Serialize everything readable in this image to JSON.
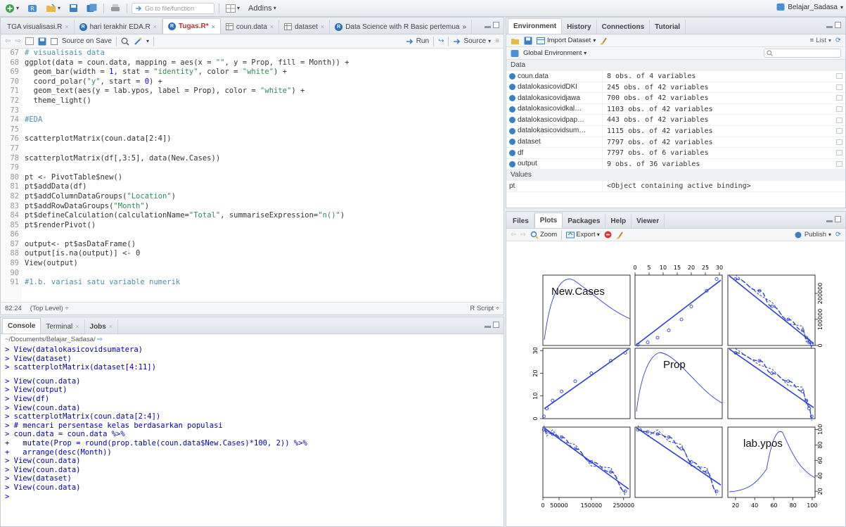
{
  "toolbar": {
    "goto_placeholder": "Go to file/function",
    "addins_label": "Addins",
    "project_name": "Belajar_Sadasa"
  },
  "editor": {
    "tabs": [
      {
        "label": "TGA visualisasi.R"
      },
      {
        "label": "hari terakhir EDA.R"
      },
      {
        "label": "Tugas.R*"
      },
      {
        "label": "coun.data"
      },
      {
        "label": "dataset"
      },
      {
        "label": "Data Science with R Basic pertemua"
      }
    ],
    "more_tabs": "»",
    "source_on_save_label": "Source on Save",
    "run_label": "Run",
    "source_label": "Source",
    "lines": [
      {
        "n": "67",
        "t": "# visualisais data",
        "cls": "cmt"
      },
      {
        "n": "68",
        "t": "ggplot(data = coun.data, mapping = aes(x = \"\", y = Prop, fill = Month)) +",
        "cls": ""
      },
      {
        "n": "69",
        "t": "  geom_bar(width = 1, stat = \"identity\", color = \"white\") +",
        "cls": ""
      },
      {
        "n": "70",
        "t": "  coord_polar(\"y\", start = 0) +",
        "cls": ""
      },
      {
        "n": "71",
        "t": "  geom_text(aes(y = lab.ypos, label = Prop), color = \"white\") +",
        "cls": ""
      },
      {
        "n": "72",
        "t": "  theme_light()",
        "cls": ""
      },
      {
        "n": "73",
        "t": "",
        "cls": ""
      },
      {
        "n": "74",
        "t": "#EDA",
        "cls": "cmt"
      },
      {
        "n": "75",
        "t": "",
        "cls": ""
      },
      {
        "n": "76",
        "t": "scatterplotMatrix(coun.data[2:4])",
        "cls": ""
      },
      {
        "n": "77",
        "t": "",
        "cls": ""
      },
      {
        "n": "78",
        "t": "scatterplotMatrix(df[,3:5], data(New.Cases))",
        "cls": ""
      },
      {
        "n": "79",
        "t": "",
        "cls": ""
      },
      {
        "n": "80",
        "t": "pt <- PivotTable$new()",
        "cls": ""
      },
      {
        "n": "81",
        "t": "pt$addData(df)",
        "cls": ""
      },
      {
        "n": "82",
        "t": "pt$addColumnDataGroups(\"Location\")",
        "cls": ""
      },
      {
        "n": "83",
        "t": "pt$addRowDataGroups(\"Month\")",
        "cls": ""
      },
      {
        "n": "84",
        "t": "pt$defineCalculation(calculationName=\"Total\", summariseExpression=\"n()\")",
        "cls": ""
      },
      {
        "n": "85",
        "t": "pt$renderPivot()",
        "cls": ""
      },
      {
        "n": "86",
        "t": "",
        "cls": ""
      },
      {
        "n": "87",
        "t": "output<- pt$asDataFrame()",
        "cls": ""
      },
      {
        "n": "88",
        "t": "output[is.na(output)] <- 0",
        "cls": ""
      },
      {
        "n": "89",
        "t": "View(output)",
        "cls": ""
      },
      {
        "n": "90",
        "t": "",
        "cls": ""
      },
      {
        "n": "91",
        "t": "#1.b. variasi satu variable numerik",
        "cls": "cmt"
      }
    ],
    "cursor_pos": "82:24",
    "scope": "(Top Level)",
    "file_type": "R Script"
  },
  "console": {
    "tabs": [
      {
        "label": "Console"
      },
      {
        "label": "Terminal"
      },
      {
        "label": "Jobs"
      }
    ],
    "path": "~/Documents/Belajar_Sadasa/",
    "lines_a": [
      "> View(datalokasicovidsumatera)",
      "> View(dataset)",
      "> scatterplotMatrix(dataset[4:11])"
    ],
    "lines_b": [
      "> View(coun.data)",
      "> View(output)",
      "> View(df)",
      "> View(coun.data)",
      "> scatterplotMatrix(coun.data[2:4])",
      "> # mencari persentase kelas berdasarkan populasi",
      "> coun.data = coun.data %>%",
      "+   mutate(Prop = round(prop.table(coun.data$New.Cases)*100, 2)) %>%",
      "+   arrange(desc(Month))",
      "> View(coun.data)",
      "> View(coun.data)",
      "> View(dataset)",
      "> View(coun.data)",
      "> "
    ]
  },
  "env": {
    "tabs": [
      {
        "label": "Environment"
      },
      {
        "label": "History"
      },
      {
        "label": "Connections"
      },
      {
        "label": "Tutorial"
      }
    ],
    "import_label": "Import Dataset",
    "list_label": "List",
    "scope_label": "Global Environment",
    "data_header": "Data",
    "values_header": "Values",
    "rows": [
      {
        "name": "coun.data",
        "value": "8 obs. of 4 variables"
      },
      {
        "name": "datalokasicovidDKI",
        "value": "245 obs. of 42 variables"
      },
      {
        "name": "datalokasicovidjawa",
        "value": "700 obs. of 42 variables"
      },
      {
        "name": "datalokasicovidkal…",
        "value": "1103 obs. of 42 variables"
      },
      {
        "name": "datalokasicovidpap…",
        "value": "443 obs. of 42 variables"
      },
      {
        "name": "datalokasicovidsum…",
        "value": "1115 obs. of 42 variables"
      },
      {
        "name": "dataset",
        "value": "7797 obs. of 42 variables"
      },
      {
        "name": "df",
        "value": "7797 obs. of 6 variables"
      },
      {
        "name": "output",
        "value": "9 obs. of 36 variables"
      }
    ],
    "value_rows": [
      {
        "name": "pt",
        "value": "<Object containing active binding>"
      }
    ]
  },
  "plots": {
    "tabs": [
      {
        "label": "Files"
      },
      {
        "label": "Plots"
      },
      {
        "label": "Packages"
      },
      {
        "label": "Help"
      },
      {
        "label": "Viewer"
      }
    ],
    "zoom_label": "Zoom",
    "export_label": "Export",
    "publish_label": "Publish"
  },
  "chart_data": {
    "type": "scatter",
    "variables": [
      "New.Cases",
      "Prop",
      "lab.ypos"
    ],
    "axes": {
      "New.Cases": {
        "ticks": [
          "0",
          "50000",
          "150000",
          "250000"
        ],
        "range": [
          0,
          270000
        ]
      },
      "Prop": {
        "ticks": [
          "0",
          "5",
          "10",
          "15",
          "20",
          "25",
          "30"
        ],
        "range": [
          0,
          31
        ]
      },
      "lab.ypos": {
        "ticks": [
          "20",
          "40",
          "60",
          "80",
          "100"
        ],
        "range": [
          12,
          103
        ]
      },
      "New.Cases_right": {
        "ticks": [
          "0",
          "100000",
          "200000"
        ],
        "range": [
          0,
          270000
        ]
      }
    },
    "points": [
      {
        "New.Cases": 3000,
        "Prop": 1.0,
        "lab.ypos": 99.5
      },
      {
        "New.Cases": 12000,
        "Prop": 4.5,
        "lab.ypos": 96.8
      },
      {
        "New.Cases": 30000,
        "Prop": 8.0,
        "lab.ypos": 94.0
      },
      {
        "New.Cases": 58000,
        "Prop": 12.0,
        "lab.ypos": 90.0
      },
      {
        "New.Cases": 100000,
        "Prop": 16.5,
        "lab.ypos": 75.0
      },
      {
        "New.Cases": 150000,
        "Prop": 20.0,
        "lab.ypos": 58.0
      },
      {
        "New.Cases": 210000,
        "Prop": 25.5,
        "lab.ypos": 45.0
      },
      {
        "New.Cases": 255000,
        "Prop": 29.0,
        "lab.ypos": 20.0
      }
    ],
    "grid": false,
    "legend": "none"
  }
}
